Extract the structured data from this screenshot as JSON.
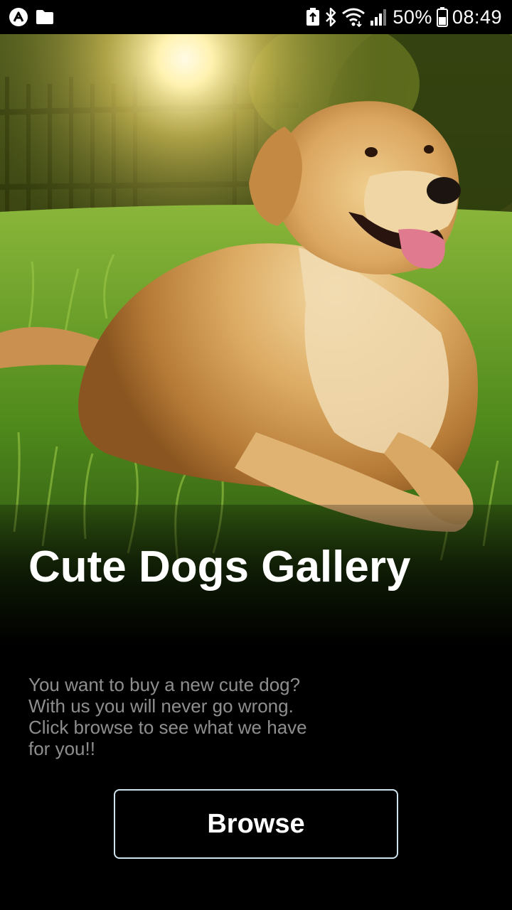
{
  "status_bar": {
    "battery_percent_label": "50%",
    "time": "08:49",
    "icons": [
      "app-logo-icon",
      "folder-icon",
      "battery-saver-icon",
      "bluetooth-icon",
      "wifi-icon",
      "signal-icon",
      "battery-icon"
    ]
  },
  "hero": {
    "image_subject": "golden retriever lying in sunlit grass",
    "icon": "dog-photo"
  },
  "content": {
    "title": "Cute Dogs Gallery",
    "description_lines": [
      "You want to buy a new cute dog?",
      "With us you will never go wrong.",
      "Click browse to see what we have",
      "for you!!"
    ]
  },
  "actions": {
    "browse_label": "Browse"
  },
  "colors": {
    "background": "#000000",
    "title": "#ffffff",
    "description": "#8e8e8e",
    "button_border": "#cfe3ee"
  }
}
